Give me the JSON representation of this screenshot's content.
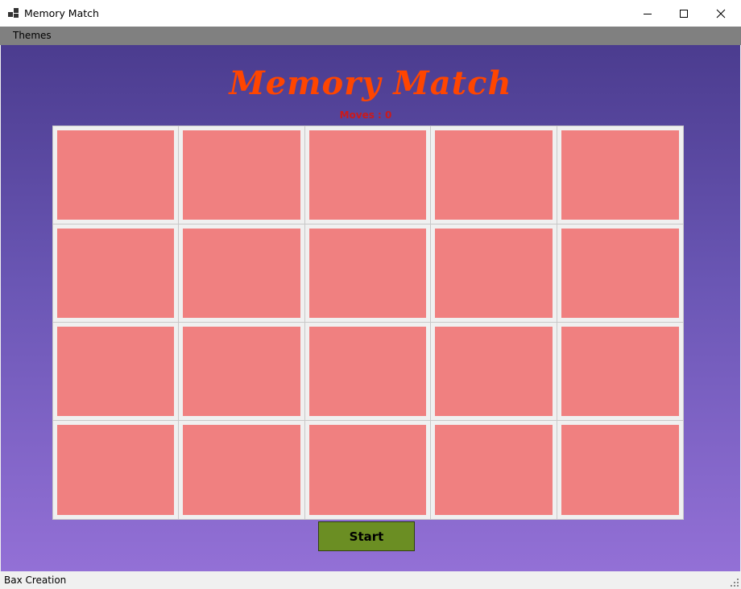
{
  "window": {
    "title": "Memory Match",
    "icon": "app-icon"
  },
  "menu": {
    "items": [
      {
        "label": "Themes"
      }
    ]
  },
  "game": {
    "title": "Memory Match",
    "moves_label": "Moves : 0",
    "grid": {
      "rows": 4,
      "columns": 5
    },
    "cards": [
      {
        "state": "face-down"
      },
      {
        "state": "face-down"
      },
      {
        "state": "face-down"
      },
      {
        "state": "face-down"
      },
      {
        "state": "face-down"
      },
      {
        "state": "face-down"
      },
      {
        "state": "face-down"
      },
      {
        "state": "face-down"
      },
      {
        "state": "face-down"
      },
      {
        "state": "face-down"
      },
      {
        "state": "face-down"
      },
      {
        "state": "face-down"
      },
      {
        "state": "face-down"
      },
      {
        "state": "face-down"
      },
      {
        "state": "face-down"
      },
      {
        "state": "face-down"
      },
      {
        "state": "face-down"
      },
      {
        "state": "face-down"
      },
      {
        "state": "face-down"
      },
      {
        "state": "face-down"
      }
    ],
    "start_label": "Start"
  },
  "status": {
    "text": "Bax Creation"
  },
  "colors": {
    "title_color": "#ff4500",
    "moves_color": "#cc1a1a",
    "card_back": "#f08080",
    "start_button": "#6b8e23",
    "background_top": "#4b3c8f",
    "background_bottom": "#9370d6",
    "menubar": "#808080"
  }
}
